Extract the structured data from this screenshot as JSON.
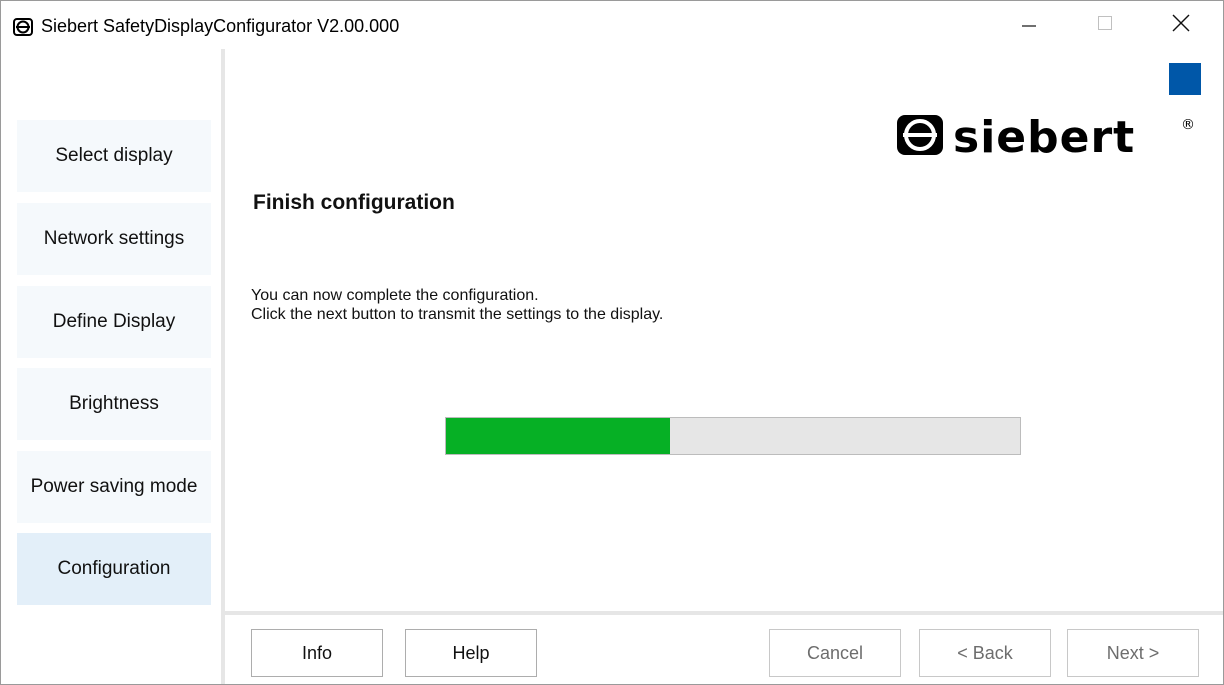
{
  "window": {
    "title": "Siebert SafetyDisplayConfigurator V2.00.000",
    "app_icon": "siebert-logo-icon",
    "controls": {
      "minimize": "minimize-icon",
      "maximize": "maximize-icon",
      "close": "close-icon"
    }
  },
  "sidebar": {
    "items": [
      {
        "label": "Select display",
        "active": false
      },
      {
        "label": "Network settings",
        "active": false
      },
      {
        "label": "Define Display",
        "active": false
      },
      {
        "label": "Brightness",
        "active": false
      },
      {
        "label": "Power saving mode",
        "active": false
      },
      {
        "label": "Configuration",
        "active": true
      }
    ]
  },
  "main": {
    "logo_text": "siebert",
    "logo_mark": "®",
    "title": "Finish configuration",
    "description_line1": "You can now complete the configuration.",
    "description_line2": "Click the next button to transmit the settings to the display.",
    "progress_percent": 39
  },
  "footer": {
    "info_label": "Info",
    "help_label": "Help",
    "cancel_label": "Cancel",
    "back_label": "< Back",
    "next_label": "Next >"
  },
  "colors": {
    "accent_blue": "#0057a8",
    "progress_green": "#06b025",
    "nav_active": "#e3eff9",
    "nav_default": "#f5f9fc"
  }
}
